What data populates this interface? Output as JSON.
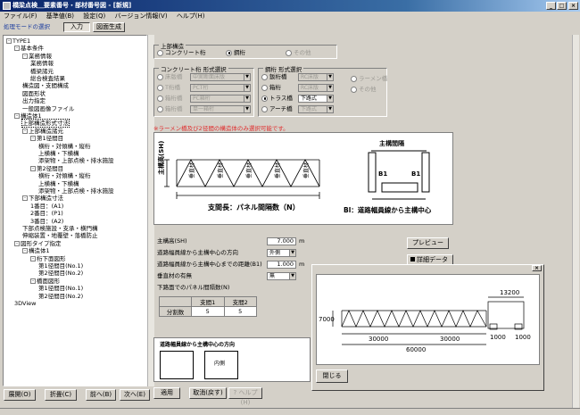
{
  "window": {
    "title": "橋梁点検＿要素番号・部材番号図 - [新規]"
  },
  "menu": [
    "ファイル(F)",
    "基準値(B)",
    "設定(Q)",
    "バージョン情報(V)",
    "ヘルプ(H)"
  ],
  "mode": {
    "label": "処理モードの選択",
    "input_label": "入力",
    "drawing_label": "図面生成"
  },
  "tree": [
    {
      "text": "TYPE1",
      "level": 0,
      "exp": "-"
    },
    {
      "text": "基本条件",
      "level": 1,
      "exp": "-"
    },
    {
      "text": "業務情報",
      "level": 2,
      "exp": "-"
    },
    {
      "text": "業務情報",
      "level": 3
    },
    {
      "text": "橋梁諸元",
      "level": 3
    },
    {
      "text": "総合検査結果",
      "level": 3
    },
    {
      "text": "構造図・支間構成",
      "level": 2
    },
    {
      "text": "図面形状",
      "level": 2
    },
    {
      "text": "出力指定",
      "level": 2
    },
    {
      "text": "一般図画像ファイル",
      "level": 2
    },
    {
      "text": "構造体1",
      "level": 1,
      "exp": "-"
    },
    {
      "text": "上部構造形式寸法",
      "level": 2,
      "selected": true
    },
    {
      "text": "上部構造諸元",
      "level": 2,
      "exp": "-"
    },
    {
      "text": "第1径間目",
      "level": 3,
      "exp": "-"
    },
    {
      "text": "横桁・対傾構・縦桁",
      "level": 4
    },
    {
      "text": "上横構・下横構",
      "level": 4
    },
    {
      "text": "添架物・上部点検・排水施設",
      "level": 4
    },
    {
      "text": "第2径間目",
      "level": 3,
      "exp": "-"
    },
    {
      "text": "横桁・対傾構・縦桁",
      "level": 4
    },
    {
      "text": "上横構・下横構",
      "level": 4
    },
    {
      "text": "添架物・上部点検・排水施設",
      "level": 4
    },
    {
      "text": "下部構造寸法",
      "level": 2,
      "exp": "-"
    },
    {
      "text": "1番目：(A1)",
      "level": 3
    },
    {
      "text": "2番目：(P1)",
      "level": 3
    },
    {
      "text": "3番目：(A2)",
      "level": 3
    },
    {
      "text": "下部点検施設・支承・横門構",
      "level": 2
    },
    {
      "text": "伸縮装置・地覆壁・落橋防止",
      "level": 2
    },
    {
      "text": "図形タイプ指定",
      "level": 1,
      "exp": "-"
    },
    {
      "text": "構造体1",
      "level": 2,
      "exp": "-"
    },
    {
      "text": "桁下面図形",
      "level": 3,
      "exp": "-"
    },
    {
      "text": "第1径間目(No.1)",
      "level": 4
    },
    {
      "text": "第2径間目(No.2)",
      "level": 4
    },
    {
      "text": "橋面図形",
      "level": 3,
      "exp": "-"
    },
    {
      "text": "第1径間目(No.1)",
      "level": 4
    },
    {
      "text": "第2径間目(No.2)",
      "level": 4
    },
    {
      "text": "3DView",
      "level": 1
    }
  ],
  "tree_buttons": {
    "expand": "展開(O)",
    "collapse": "折畳(C)",
    "prev": "前へ(B)",
    "next": "次へ(E)"
  },
  "upper": {
    "group_label": "上部構造",
    "concrete_label": "コンクリート桁",
    "steel_label": "鋼桁",
    "other_label": "その他"
  },
  "concrete_form": {
    "group_label": "コンクリート桁 形式選択",
    "options": [
      {
        "label": "床版橋",
        "combo": "中実断面床版"
      },
      {
        "label": "T桁橋",
        "combo": "PCT桁"
      },
      {
        "label": "箱桁橋",
        "combo": "PC箱桁"
      },
      {
        "label": "箱桁橋",
        "combo": "単一箱桁"
      }
    ]
  },
  "steel_form": {
    "group_label": "鋼桁 形式選択",
    "options": [
      {
        "label": "鈑桁橋",
        "combo": "RC床版"
      },
      {
        "label": "箱桁",
        "combo": "RC床版"
      },
      {
        "label": "トラス橋",
        "combo": "下路式"
      },
      {
        "label": "アーチ橋",
        "combo": "下路式"
      }
    ],
    "extra": [
      "ラーメン橋",
      "その他"
    ]
  },
  "note": "※ラーメン橋及び2径間の構造体のみ選択可能です。",
  "diagram": {
    "height_label": "主構高(SH)",
    "span_label": "支間長：パネル間隔数（N）",
    "section_title": "主構間隔",
    "section_note": "Bl：道路幅員線から主構中心",
    "b1": "B1",
    "panels": [
      "垂直材",
      "垂直材",
      "垂直材",
      "垂直材",
      "垂直材"
    ]
  },
  "form": {
    "sh_label": "主構高(SH)",
    "sh_value": "7.000",
    "sh_unit": "m",
    "dir_label": "道路幅員線から主構中心の方向",
    "dir_value": "外側",
    "dist_label": "道路幅員線から主構中心までの距離(B1)",
    "dist_value": "1.000",
    "dist_unit": "m",
    "vert_label": "垂直材の有無",
    "vert_value": "無",
    "panels_label": "下路面でのパネル間隔数(N)",
    "table_headers": [
      "支間1",
      "支間2"
    ],
    "table_row_label": "分割数",
    "table_values": [
      "5",
      "5"
    ]
  },
  "bottom_preview": {
    "title": "道路幅員線から主構中心の方向",
    "inner_label": "内側"
  },
  "right_buttons": {
    "preview": "プレビュー",
    "detail": "詳細データ"
  },
  "bottom_buttons": {
    "apply": "適用",
    "cancel": "取消(戻す)",
    "help": "ヘルプ(H)"
  },
  "dialog": {
    "close": "閉じる",
    "dims": {
      "top": "13200",
      "left": "7000",
      "span1": "30000",
      "span2": "30000",
      "total": "60000",
      "right1": "1000",
      "right2": "1000"
    }
  }
}
